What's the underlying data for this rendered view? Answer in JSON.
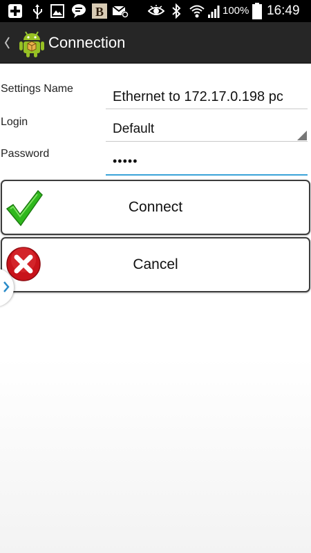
{
  "status_bar": {
    "battery_percent": "100%",
    "time": "16:49",
    "notification_icons": [
      "plus-box-icon",
      "usb-icon",
      "image-icon",
      "chat-bubble-icon",
      "b-app-icon",
      "mail-icon"
    ],
    "system_icons": [
      "eye-icon",
      "bluetooth-icon",
      "wifi-icon",
      "signal-icon",
      "battery-icon"
    ]
  },
  "action_bar": {
    "title": "Connection",
    "app_icon": "android-robot-icon"
  },
  "form": {
    "settings_name_label": "Settings Name",
    "settings_name_value": "Ethernet to 172.17.0.198 pc",
    "login_label": "Login",
    "login_value": "Default",
    "password_label": "Password",
    "password_value": "•••••"
  },
  "buttons": {
    "connect_label": "Connect",
    "cancel_label": "Cancel"
  },
  "colors": {
    "status_bar_bg": "#000000",
    "action_bar_bg": "#262626",
    "focus_underline": "#3aa3d8",
    "check_green": "#2fb81d",
    "cancel_red": "#c8131b"
  }
}
